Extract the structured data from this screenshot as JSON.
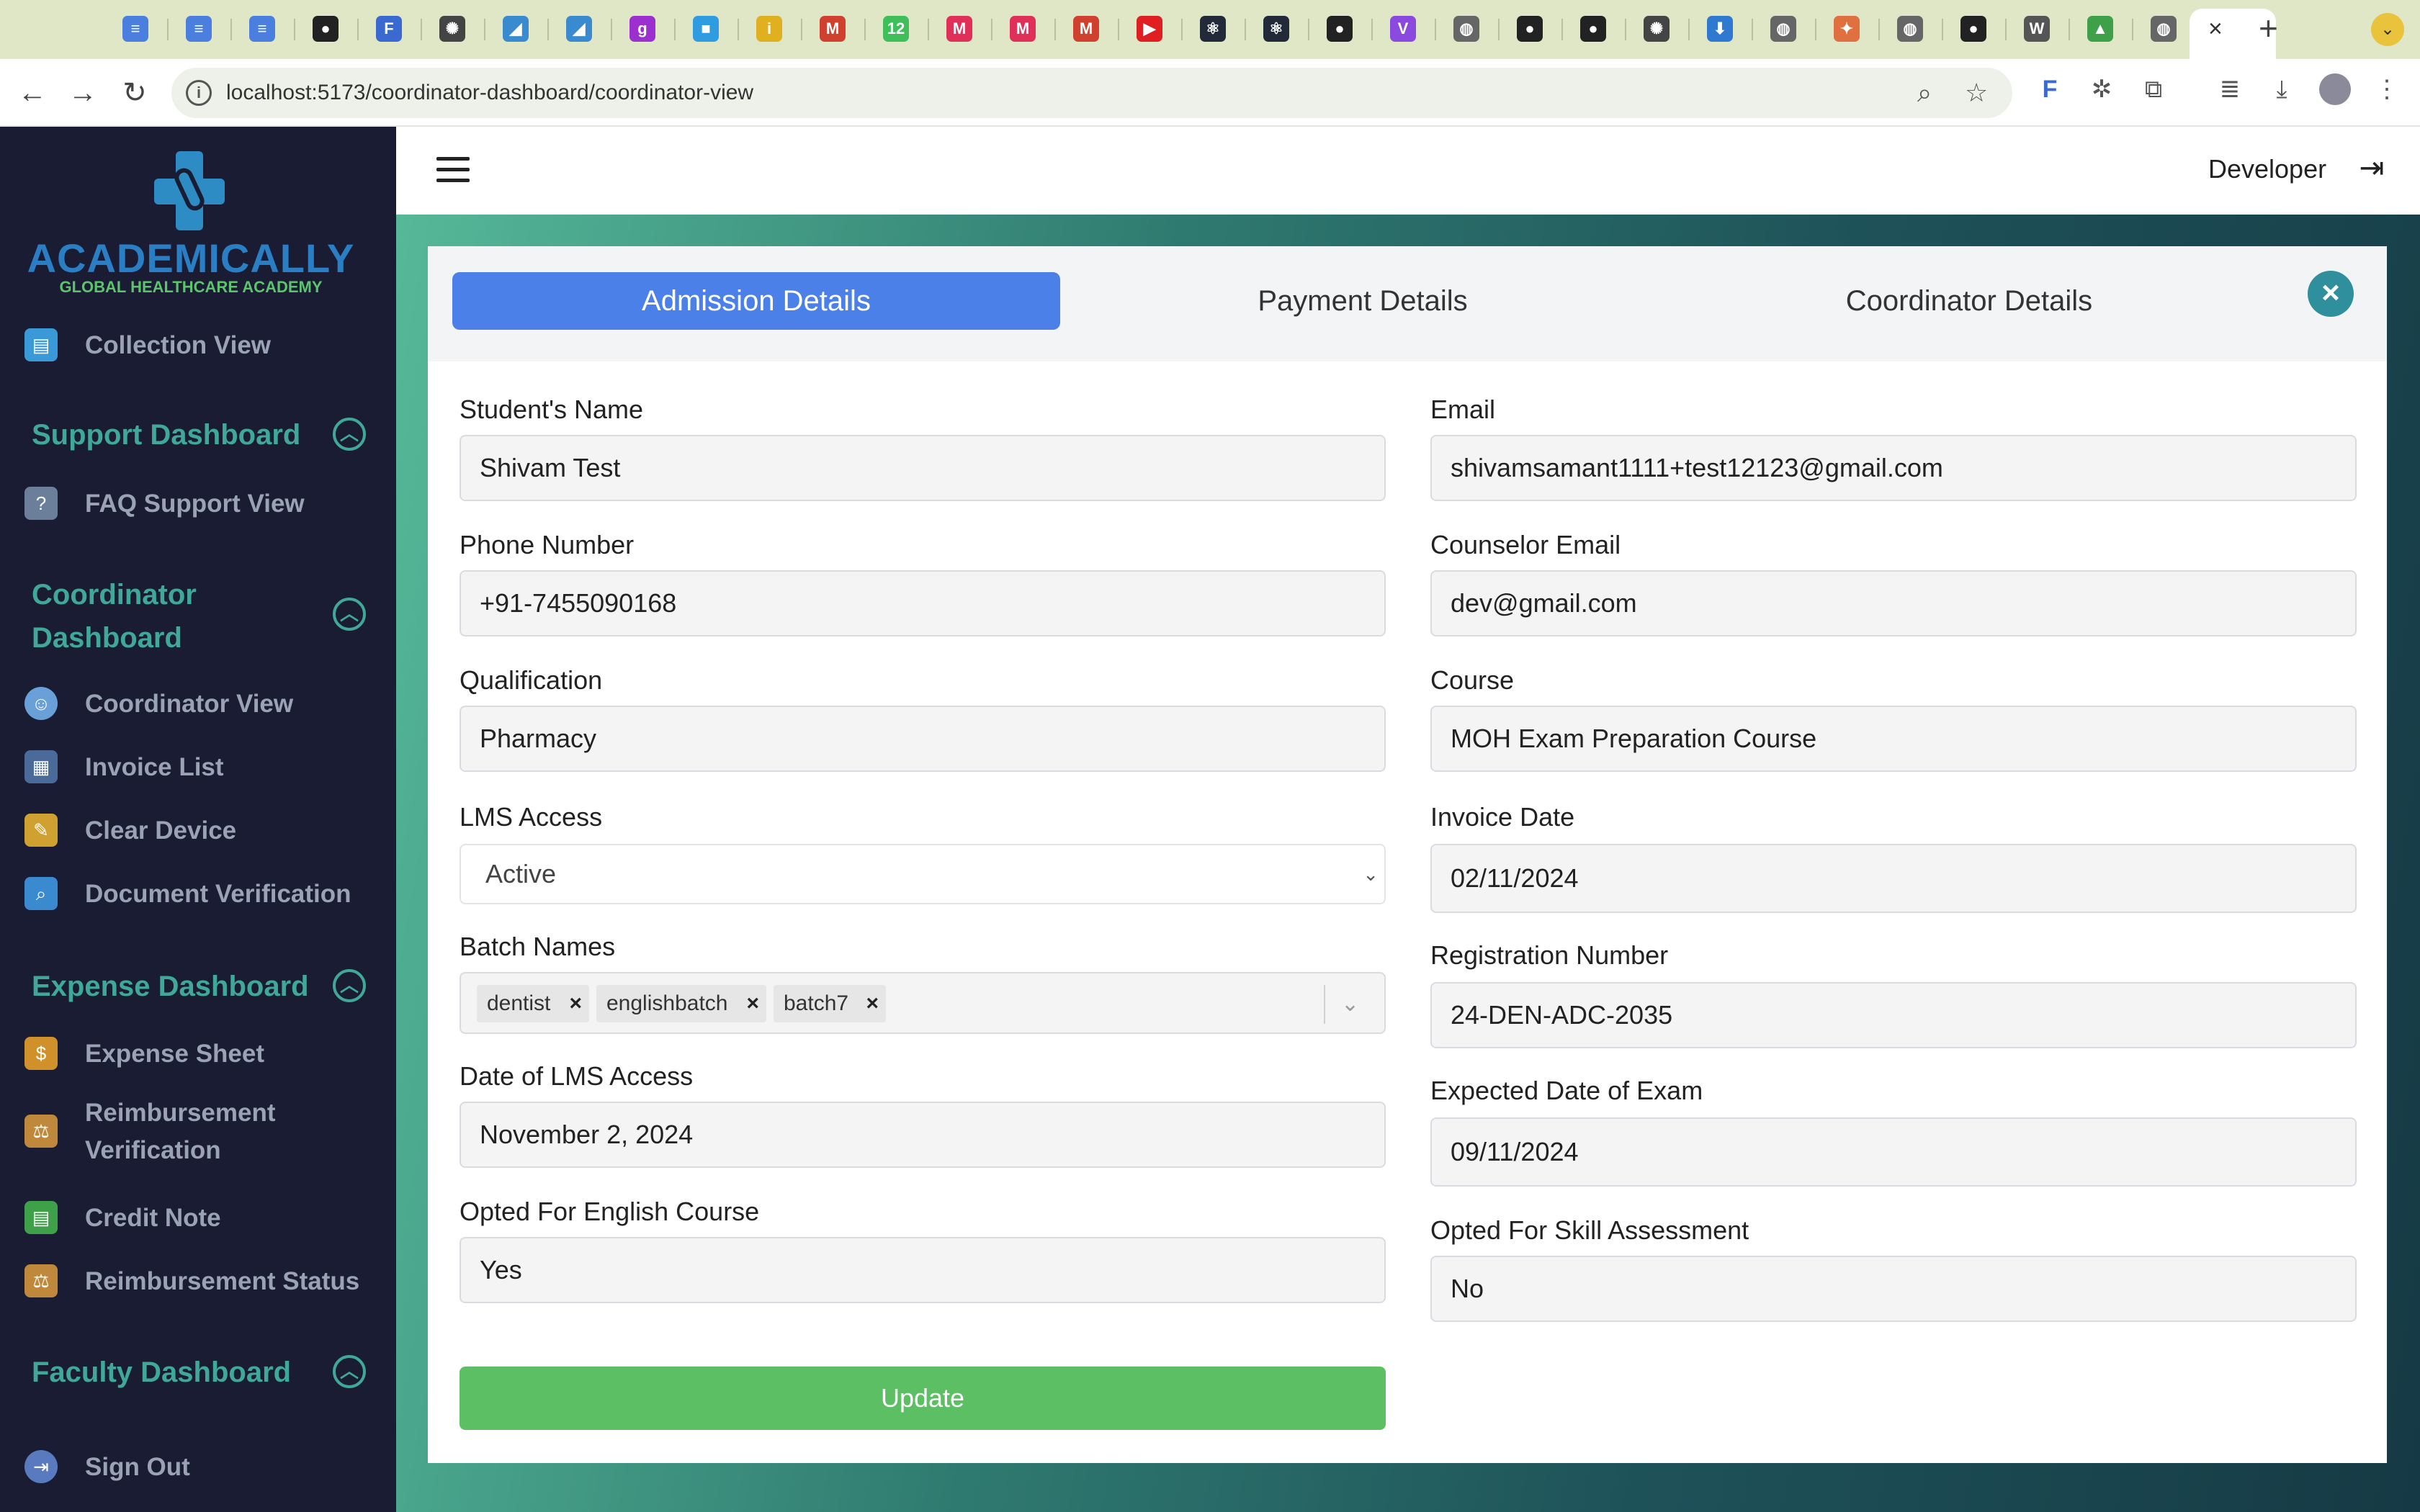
{
  "browser": {
    "tab_icons": [
      {
        "name": "docs-icon",
        "color": "#4a7fe0",
        "glyph": "≡"
      },
      {
        "name": "docs-icon",
        "color": "#4a7fe0",
        "glyph": "≡"
      },
      {
        "name": "docs-icon",
        "color": "#4a7fe0",
        "glyph": "≡"
      },
      {
        "name": "github-icon",
        "color": "#222222",
        "glyph": "●"
      },
      {
        "name": "app-icon",
        "color": "#3a6ad0",
        "glyph": "F"
      },
      {
        "name": "chatgpt-icon",
        "color": "#444444",
        "glyph": "✺"
      },
      {
        "name": "app-icon",
        "color": "#3a8ad0",
        "glyph": "◢"
      },
      {
        "name": "app-icon",
        "color": "#3a8ad0",
        "glyph": "◢"
      },
      {
        "name": "app-icon",
        "color": "#9b2fd0",
        "glyph": "g"
      },
      {
        "name": "app-icon",
        "color": "#2f9be0",
        "glyph": "■"
      },
      {
        "name": "app-icon",
        "color": "#e0b020",
        "glyph": "i"
      },
      {
        "name": "gmail-icon",
        "color": "#d0402f",
        "glyph": "M"
      },
      {
        "name": "app-icon",
        "color": "#3fbf5a",
        "glyph": "12"
      },
      {
        "name": "myntra-icon",
        "color": "#e0305a",
        "glyph": "M"
      },
      {
        "name": "myntra-icon",
        "color": "#e0305a",
        "glyph": "M"
      },
      {
        "name": "gmail-icon",
        "color": "#d0402f",
        "glyph": "M"
      },
      {
        "name": "youtube-icon",
        "color": "#e02020",
        "glyph": "▶"
      },
      {
        "name": "react-icon",
        "color": "#222a3a",
        "glyph": "⚛"
      },
      {
        "name": "react-icon",
        "color": "#222a3a",
        "glyph": "⚛"
      },
      {
        "name": "github-icon",
        "color": "#222222",
        "glyph": "●"
      },
      {
        "name": "vite-icon",
        "color": "#8a4ae0",
        "glyph": "V"
      },
      {
        "name": "globe-icon",
        "color": "#666666",
        "glyph": "◍"
      },
      {
        "name": "github-icon",
        "color": "#222222",
        "glyph": "●"
      },
      {
        "name": "github-icon",
        "color": "#222222",
        "glyph": "●"
      },
      {
        "name": "chatgpt-icon",
        "color": "#444444",
        "glyph": "✺"
      },
      {
        "name": "download-icon",
        "color": "#2f7ad0",
        "glyph": "⬇"
      },
      {
        "name": "globe-icon",
        "color": "#666666",
        "glyph": "◍"
      },
      {
        "name": "app-icon",
        "color": "#e07040",
        "glyph": "✦"
      },
      {
        "name": "globe-icon",
        "color": "#666666",
        "glyph": "◍"
      },
      {
        "name": "github-icon",
        "color": "#222222",
        "glyph": "●"
      },
      {
        "name": "wikipedia-icon",
        "color": "#555555",
        "glyph": "W"
      },
      {
        "name": "drive-icon",
        "color": "#3fa04a",
        "glyph": "▲"
      },
      {
        "name": "globe-icon",
        "color": "#666666",
        "glyph": "◍"
      }
    ],
    "active_tab_close": "×",
    "new_tab": "+",
    "tab_menu": "⌄",
    "url": "localhost:5173/coordinator-dashboard/coordinator-view",
    "back": "←",
    "forward": "→",
    "reload": "↻",
    "zoom_icon": "⌕",
    "star_icon": "☆"
  },
  "sidebar": {
    "logo_title": "ACADEMICALLY",
    "logo_subtitle": "GLOBAL HEALTHCARE ACADEMY",
    "collection_view": "Collection View",
    "support_dashboard": "Support Dashboard",
    "faq_support_view": "FAQ Support View",
    "coordinator_dashboard": "Coordinator Dashboard",
    "coordinator_view": "Coordinator View",
    "invoice_list": "Invoice List",
    "clear_device": "Clear Device",
    "document_verification": "Document Verification",
    "expense_dashboard": "Expense Dashboard",
    "expense_sheet": "Expense Sheet",
    "reimbursement_verification": "Reimbursement Verification",
    "credit_note": "Credit Note",
    "reimbursement_status": "Reimbursement Status",
    "faculty_dashboard": "Faculty Dashboard",
    "sign_out": "Sign Out"
  },
  "header": {
    "user": "Developer"
  },
  "tabs": {
    "admission": "Admission Details",
    "payment": "Payment Details",
    "coordinator": "Coordinator Details",
    "close": "×"
  },
  "form": {
    "student_name_label": "Student's Name",
    "student_name": "Shivam Test",
    "email_label": "Email",
    "email": "shivamsamant1111+test12123@gmail.com",
    "phone_label": "Phone Number",
    "phone": "+91-7455090168",
    "counselor_email_label": "Counselor Email",
    "counselor_email": "dev@gmail.com",
    "qualification_label": "Qualification",
    "qualification": "Pharmacy",
    "course_label": "Course",
    "course": "MOH Exam Preparation Course",
    "lms_access_label": "LMS Access",
    "lms_access": "Active",
    "invoice_date_label": "Invoice Date",
    "invoice_date": "02/11/2024",
    "batch_names_label": "Batch Names",
    "batch_names": [
      "dentist",
      "englishbatch",
      "batch7"
    ],
    "registration_number_label": "Registration Number",
    "registration_number": "24-DEN-ADC-2035",
    "lms_date_label": "Date of LMS Access",
    "lms_date": "November 2, 2024",
    "expected_exam_label": "Expected Date of Exam",
    "expected_exam": "09/11/2024",
    "english_course_label": "Opted For English Course",
    "english_course": "Yes",
    "skill_assessment_label": "Opted For Skill Assessment",
    "skill_assessment": "No",
    "update_button": "Update"
  }
}
